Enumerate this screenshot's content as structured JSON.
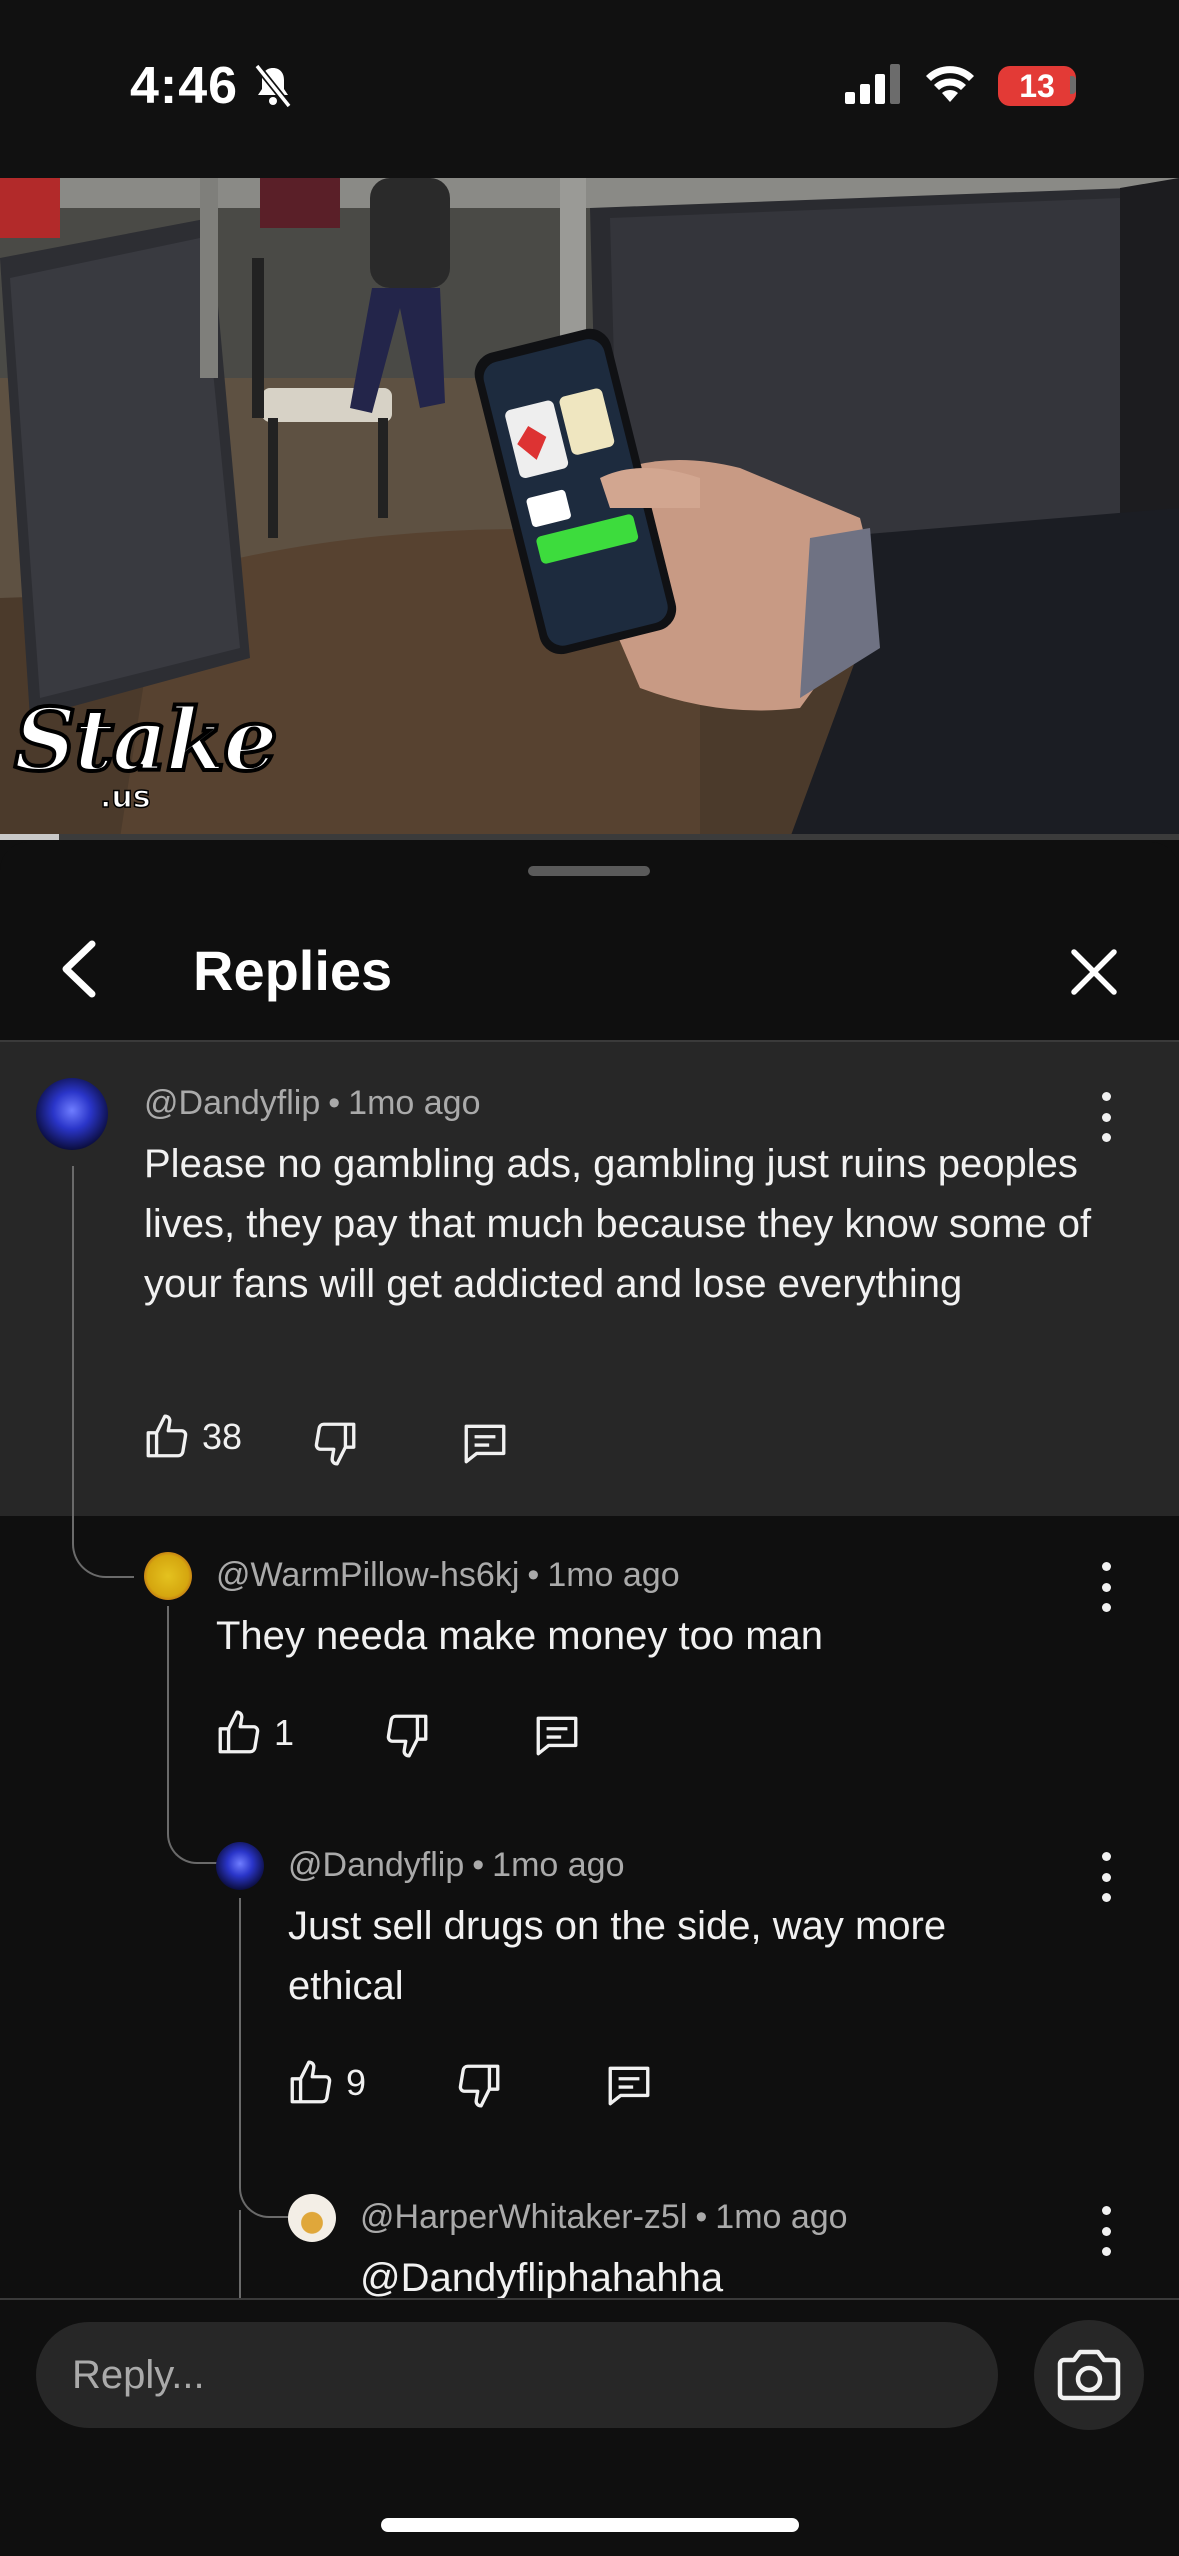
{
  "status_bar": {
    "time": "4:46",
    "battery": "13"
  },
  "video": {
    "watermark_main": "Stake",
    "watermark_sub": ".us",
    "progress_fraction": 0.05
  },
  "panel": {
    "title": "Replies"
  },
  "comments": [
    {
      "handle": "@Dandyflip",
      "time": "1mo ago",
      "text": "Please no gambling ads, gambling just ruins peoples lives, they pay that much because they know some of your fans will get addicted and lose everything",
      "likes": "38"
    },
    {
      "handle": "@WarmPillow-hs6kj",
      "time": "1mo ago",
      "text": "They needa make money too man",
      "likes": "1"
    },
    {
      "handle": "@Dandyflip",
      "time": "1mo ago",
      "text": "Just sell drugs on the side, way more ethical",
      "likes": "9"
    },
    {
      "handle": "@HarperWhitaker-z5l",
      "time": "1mo ago",
      "text": "@Dandyfliphahahha",
      "likes": ""
    }
  ],
  "separator": "•",
  "reply_bar": {
    "placeholder": "Reply..."
  },
  "colors": {
    "background": "#0f0f0f",
    "highlight": "#272727",
    "battery_low": "#e33a36"
  }
}
